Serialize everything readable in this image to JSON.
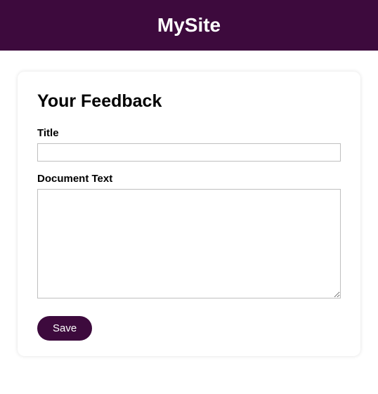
{
  "header": {
    "site_name": "MySite"
  },
  "form": {
    "heading": "Your Feedback",
    "title_label": "Title",
    "title_value": "",
    "document_text_label": "Document Text",
    "document_text_value": "",
    "save_button_label": "Save"
  },
  "colors": {
    "brand": "#3d0a3d"
  }
}
